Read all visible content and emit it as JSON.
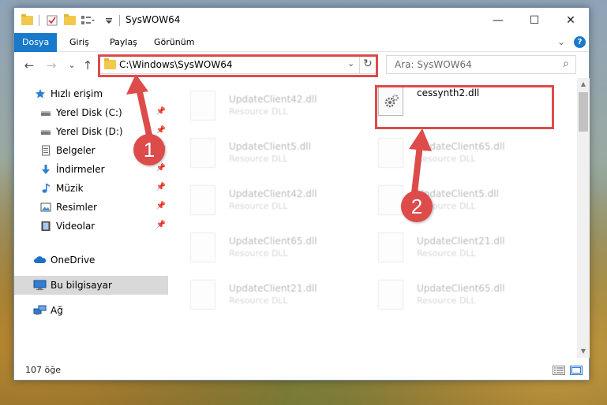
{
  "window": {
    "title": "SysWOW64",
    "controls": {
      "minimize": "—",
      "maximize": "☐",
      "close": "✕"
    }
  },
  "ribbon": {
    "tabs": [
      "Dosya",
      "Giriş",
      "Paylaş",
      "Görünüm"
    ],
    "active_tab": "Dosya",
    "help": "?",
    "collapse": "⌄"
  },
  "address_bar": {
    "path": "C:\\Windows\\SysWOW64",
    "dropdown": "⌄",
    "refresh": "↻"
  },
  "nav_buttons": {
    "back": "←",
    "forward": "→",
    "recent": "⌄",
    "up": "↑"
  },
  "search": {
    "placeholder": "Ara: SysWOW64",
    "icon": "⌕"
  },
  "sidebar": {
    "items": [
      {
        "label": "Hızlı erişim",
        "icon": "star-icon",
        "pinned": false
      },
      {
        "label": "Yerel Disk (C:)",
        "icon": "drive-icon",
        "pinned": true
      },
      {
        "label": "Yerel Disk (D:)",
        "icon": "drive-icon",
        "pinned": true
      },
      {
        "label": "Belgeler",
        "icon": "document-icon",
        "pinned": true
      },
      {
        "label": "İndirmeler",
        "icon": "download-icon",
        "pinned": true
      },
      {
        "label": "Müzik",
        "icon": "music-icon",
        "pinned": true
      },
      {
        "label": "Resimler",
        "icon": "pictures-icon",
        "pinned": true
      },
      {
        "label": "Videolar",
        "icon": "video-icon",
        "pinned": true
      },
      {
        "label": "OneDrive",
        "icon": "cloud-icon",
        "pinned": false
      },
      {
        "label": "Bu bilgisayar",
        "icon": "computer-icon",
        "pinned": false,
        "selected": true
      },
      {
        "label": "Ağ",
        "icon": "network-icon",
        "pinned": false
      }
    ]
  },
  "files": {
    "left_column": [
      {
        "name": "UpdateClient42.dll",
        "type": "Resource DLL"
      },
      {
        "name": "UpdateClient5.dll",
        "type": "Resource DLL"
      },
      {
        "name": "UpdateClient42.dll",
        "type": "Resource DLL"
      },
      {
        "name": "UpdateClient65.dll",
        "type": "Resource DLL"
      },
      {
        "name": "UpdateClient21.dll",
        "type": "Resource DLL"
      }
    ],
    "right_column": [
      {
        "name": "cessynth2.dll",
        "type": "",
        "highlighted": true
      },
      {
        "name": "UpdateClient65.dll",
        "type": "Resource DLL"
      },
      {
        "name": "UpdateClient5.dll",
        "type": "Resource DLL"
      },
      {
        "name": "UpdateClient21.dll",
        "type": "Resource DLL"
      },
      {
        "name": "UpdateClient65.dll",
        "type": "Resource DLL"
      }
    ]
  },
  "status_bar": {
    "item_count": "107 öğe"
  },
  "annotations": {
    "step1": "1",
    "step2": "2",
    "color": "#dd4b4b"
  },
  "colors": {
    "accent": "#1979ca",
    "folder": "#f2c94c",
    "annotation": "#dd4b4b"
  }
}
